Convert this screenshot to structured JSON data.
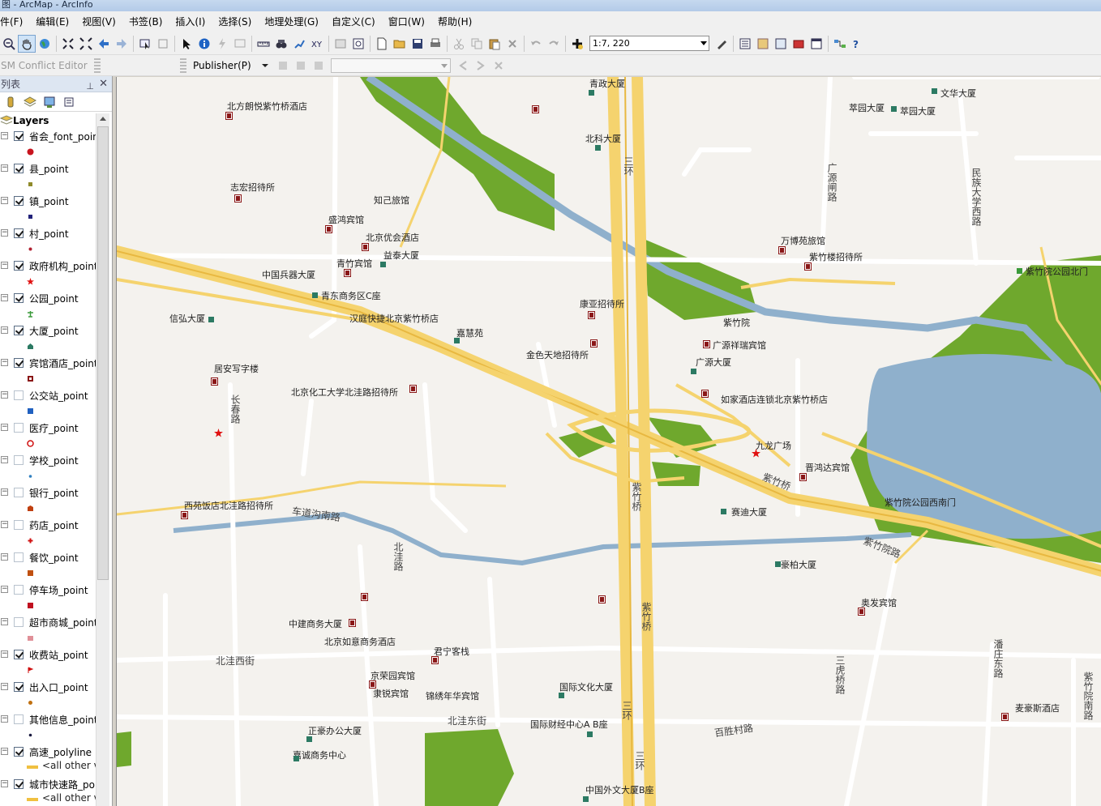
{
  "window": {
    "title": "图 - ArcMap - ArcInfo"
  },
  "menu": [
    "件(F)",
    "编辑(E)",
    "视图(V)",
    "书签(B)",
    "插入(I)",
    "选择(S)",
    "地理处理(G)",
    "自定义(C)",
    "窗口(W)",
    "帮助(H)"
  ],
  "toolbar": {
    "scale": "1:7, 220"
  },
  "toolbar2": {
    "conflict_editor": "SM Conflict Editor",
    "publisher": "Publisher(P)"
  },
  "toc": {
    "title": "列表",
    "root": "Layers",
    "layers": [
      {
        "name": "省会_font_point",
        "checked": true,
        "symbol": "red-dot-icon",
        "color": "#c8141e"
      },
      {
        "name": "县_point",
        "checked": true,
        "symbol": "square-icon",
        "color": "#8f8a2a"
      },
      {
        "name": "镇_point",
        "checked": true,
        "symbol": "square-icon",
        "color": "#22227a"
      },
      {
        "name": "村_point",
        "checked": true,
        "symbol": "dot-icon",
        "color": "#b02030"
      },
      {
        "name": "政府机构_point",
        "checked": true,
        "symbol": "star-icon",
        "color": "#e01010"
      },
      {
        "name": "公园_point",
        "checked": true,
        "symbol": "tree-icon",
        "color": "#3a9a3a"
      },
      {
        "name": "大厦_point",
        "checked": true,
        "symbol": "building-icon",
        "color": "#2c7a63"
      },
      {
        "name": "宾馆酒店_point",
        "checked": true,
        "symbol": "hotel-icon",
        "color": "#8a1717"
      },
      {
        "name": "公交站_point",
        "checked": false,
        "symbol": "bus-icon",
        "color": "#2060c0"
      },
      {
        "name": "医疗_point",
        "checked": false,
        "symbol": "cross-icon",
        "color": "#d01010"
      },
      {
        "name": "学校_point",
        "checked": false,
        "symbol": "school-icon",
        "color": "#3080c0"
      },
      {
        "name": "银行_point",
        "checked": false,
        "symbol": "bank-icon",
        "color": "#c04010"
      },
      {
        "name": "药店_point",
        "checked": false,
        "symbol": "pharmacy-icon",
        "color": "#d01010"
      },
      {
        "name": "餐饮_point",
        "checked": false,
        "symbol": "restaurant-icon",
        "color": "#c05010"
      },
      {
        "name": "停车场_point",
        "checked": false,
        "symbol": "parking-icon",
        "color": "#c01020"
      },
      {
        "name": "超市商城_point",
        "checked": false,
        "symbol": "shop-icon",
        "color": "#c02030"
      },
      {
        "name": "收费站_point",
        "checked": true,
        "symbol": "flag-icon",
        "color": "#d01010"
      },
      {
        "name": "出入口_point",
        "checked": true,
        "symbol": "dot-icon",
        "color": "#c07010"
      },
      {
        "name": "其他信息_point",
        "checked": false,
        "symbol": "dot-icon",
        "color": "#1a1a40"
      },
      {
        "name": "高速_polyline",
        "checked": true,
        "symbol": "line-icon",
        "color": "#f0c040",
        "sub": "<all other v"
      },
      {
        "name": "城市快速路_po",
        "checked": true,
        "symbol": "line-icon",
        "color": "#f0c040",
        "sub": "<all other v"
      }
    ]
  },
  "map": {
    "colors": {
      "background": "#f4f2ee",
      "water": "#8fb0cc",
      "park": "#6fa82d",
      "highway": "#f5d36e",
      "road": "#ffffff"
    },
    "labels": [
      "青政大厦",
      "文华大厦",
      "北方朗悦紫竹桥酒店",
      "萃园大厦",
      "萃园大厦",
      "北科大厦",
      "志宏招待所",
      "知己旅馆",
      "盛鸿宾馆",
      "北京优会酒店",
      "青竹宾馆",
      "益泰大厦",
      "中国兵器大厦",
      "青东商务区C座",
      "万博苑旅馆",
      "紫竹楼招待所",
      "紫竹院公园北门",
      "康亚招待所",
      "信弘大厦",
      "汉庭快捷北京紫竹桥店",
      "嘉慧苑",
      "紫竹院",
      "广源祥瑞宾馆",
      "金色天地招待所",
      "广源大厦",
      "居安写字楼",
      "北京化工大学北洼路招待所",
      "如家酒店连锁北京紫竹桥店",
      "九龙广场",
      "晋鸿达宾馆",
      "西苑饭店北洼路招待所",
      "紫竹院公园西南门",
      "赛迪大厦",
      "豪柏大厦",
      "奥发宾馆",
      "中建商务大厦",
      "北京如意商务酒店",
      "君宁客栈",
      "京荣园宾馆",
      "隶锐宾馆",
      "锦绣年华宾馆",
      "国际文化大厦",
      "国际财经中心A B座",
      "麦豪斯酒店",
      "正豪办公大厦",
      "嘉诚商务中心",
      "中国外文大厦B座"
    ],
    "road_labels": [
      "三环",
      "广源闸路",
      "民族大学西路",
      "车道沟南路",
      "长春路",
      "北洼路",
      "紫竹桥",
      "紫竹桥",
      "紫竹院路",
      "紫竹桥",
      "北洼西街",
      "北洼东街",
      "三虎桥路",
      "潘庄东路",
      "紫竹院南路",
      "百胜村路",
      "三环",
      "三环"
    ]
  }
}
